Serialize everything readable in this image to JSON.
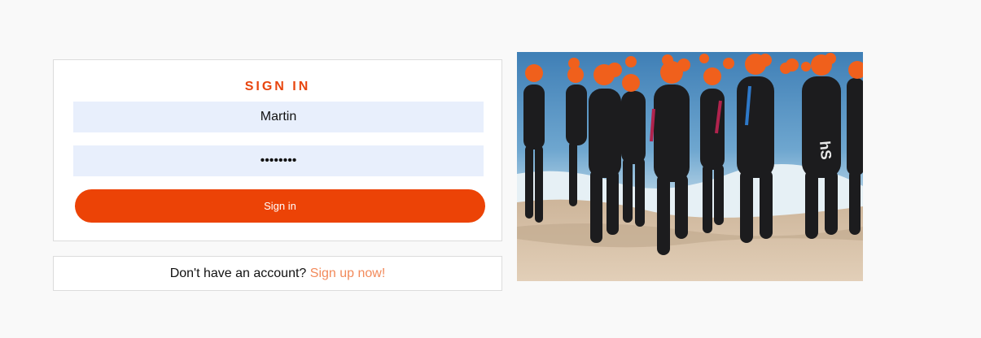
{
  "login": {
    "title": "SIGN IN",
    "username_value": "Martin",
    "password_value": "password",
    "submit_label": "Sign in"
  },
  "signup": {
    "prompt": "Don't have an account?",
    "link_label": "Sign up now!"
  },
  "colors": {
    "accent": "#ec4306",
    "link": "#f28a5b",
    "input_bg": "#e8effc",
    "page_bg": "#f9f9f9"
  }
}
